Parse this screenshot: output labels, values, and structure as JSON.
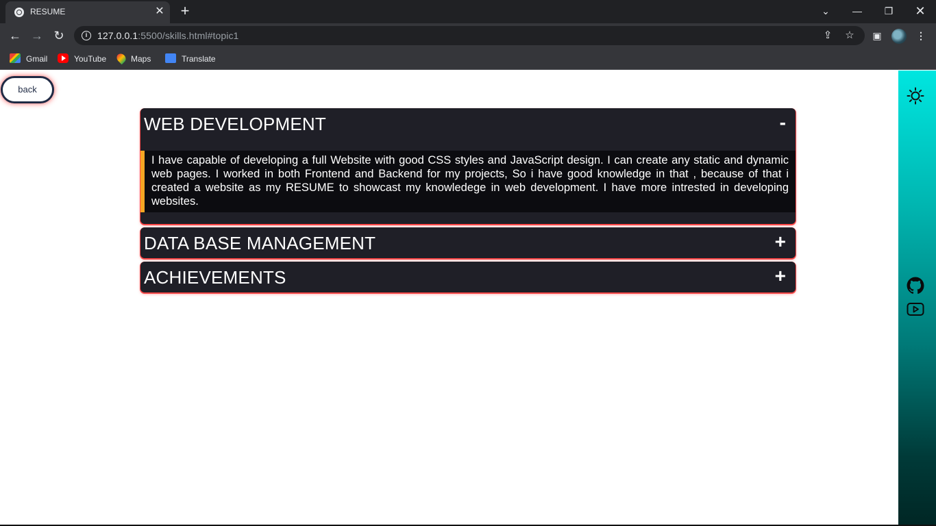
{
  "browser": {
    "tab_title": "RESUME",
    "tab_close": "✕",
    "new_tab": "+",
    "url_host": "127.0.0.1",
    "url_rest": ":5500/skills.html#topic1",
    "bookmarks": [
      {
        "label": "Gmail",
        "icon": "gmail-icon"
      },
      {
        "label": "YouTube",
        "icon": "youtube-icon"
      },
      {
        "label": "Maps",
        "icon": "maps-icon"
      },
      {
        "label": "Translate",
        "icon": "translate-icon"
      }
    ]
  },
  "page": {
    "back_label": "back",
    "accordion": [
      {
        "title": "WEB DEVELOPMENT",
        "toggle": "-",
        "expanded": true,
        "body": "I have capable of developing a full Website with good CSS styles and JavaScript design. I can create any static and dynamic web pages. I worked in both Frontend and Backend for my projects, So i have good knowledge in that , because of that i created a website as my RESUME to showcast my knowledege in web development. I have more intrested in developing websites."
      },
      {
        "title": "DATA BASE MANAGEMENT",
        "toggle": "+",
        "expanded": false
      },
      {
        "title": "ACHIEVEMENTS",
        "toggle": "+",
        "expanded": false
      }
    ]
  },
  "sidebar": {
    "icons": [
      "sun-icon",
      "github-icon",
      "youtube-icon"
    ],
    "gradient_top": "#00e6e0",
    "gradient_bottom": "#002624"
  },
  "colors": {
    "accordion_bg": "#1f1f27",
    "accent_bar": "#f5a623",
    "glow": "#ff3c3c"
  }
}
